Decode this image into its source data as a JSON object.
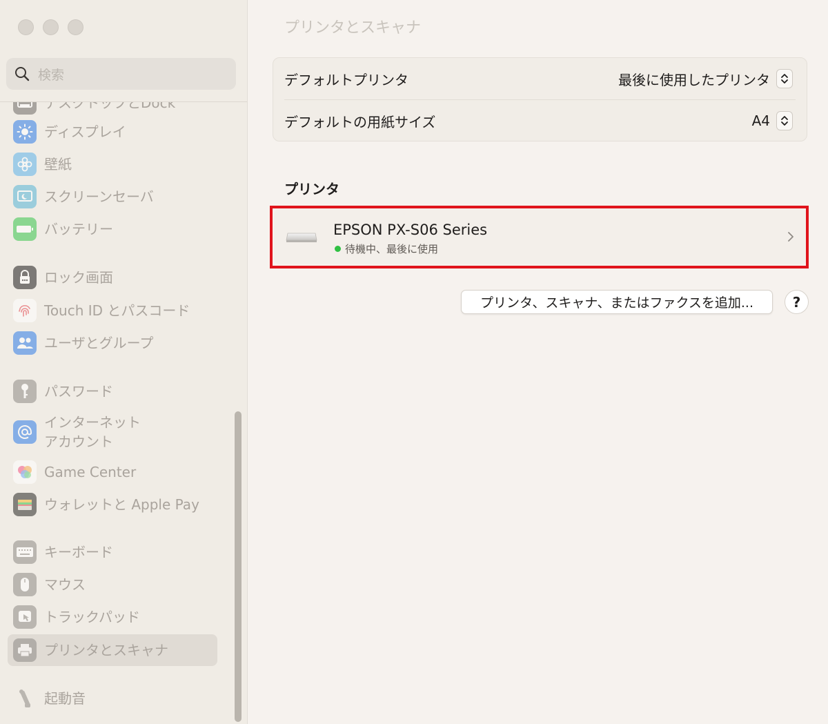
{
  "window": {
    "title": "プリンタとスキャナ"
  },
  "sidebar": {
    "search": {
      "placeholder": "検索"
    },
    "partial_item": {
      "label": "デスクトップとDock"
    },
    "items": [
      {
        "label": "ディスプレイ",
        "icon": "sun-icon"
      },
      {
        "label": "壁紙",
        "icon": "flower-icon"
      },
      {
        "label": "スクリーンセーバ",
        "icon": "screen-saver-icon"
      },
      {
        "label": "バッテリー",
        "icon": "battery-icon"
      },
      {
        "label": "ロック画面",
        "icon": "lock-icon"
      },
      {
        "label": "Touch ID とパスコード",
        "icon": "fingerprint-icon"
      },
      {
        "label": "ユーザとグループ",
        "icon": "users-icon"
      },
      {
        "label": "パスワード",
        "icon": "key-icon"
      },
      {
        "label": "インターネット",
        "label2": "アカウント",
        "icon": "at-icon"
      },
      {
        "label": "Game Center",
        "icon": "game-center-icon"
      },
      {
        "label": "ウォレットと Apple Pay",
        "icon": "wallet-icon"
      },
      {
        "label": "キーボード",
        "icon": "keyboard-icon"
      },
      {
        "label": "マウス",
        "icon": "mouse-icon"
      },
      {
        "label": "トラックパッド",
        "icon": "trackpad-icon"
      },
      {
        "label": "プリンタとスキャナ",
        "icon": "printer-icon"
      },
      {
        "label": "起動音",
        "icon": "speaker-icon"
      }
    ],
    "selected": "プリンタとスキャナ"
  },
  "settings": {
    "default_printer": {
      "label": "デフォルトプリンタ",
      "value": "最後に使用したプリンタ"
    },
    "default_paper": {
      "label": "デフォルトの用紙サイズ",
      "value": "A4"
    }
  },
  "printers": {
    "section_label": "プリンタ",
    "items": [
      {
        "name": "EPSON PX-S06 Series",
        "status": "待機中、最後に使用",
        "status_color": "#2fc043"
      }
    ]
  },
  "actions": {
    "add_label": "プリンタ、スキャナ、またはファクスを追加...",
    "help_label": "?"
  },
  "colors": {
    "highlight": "#e0141c",
    "selected_bg": "#e0dbd4"
  }
}
